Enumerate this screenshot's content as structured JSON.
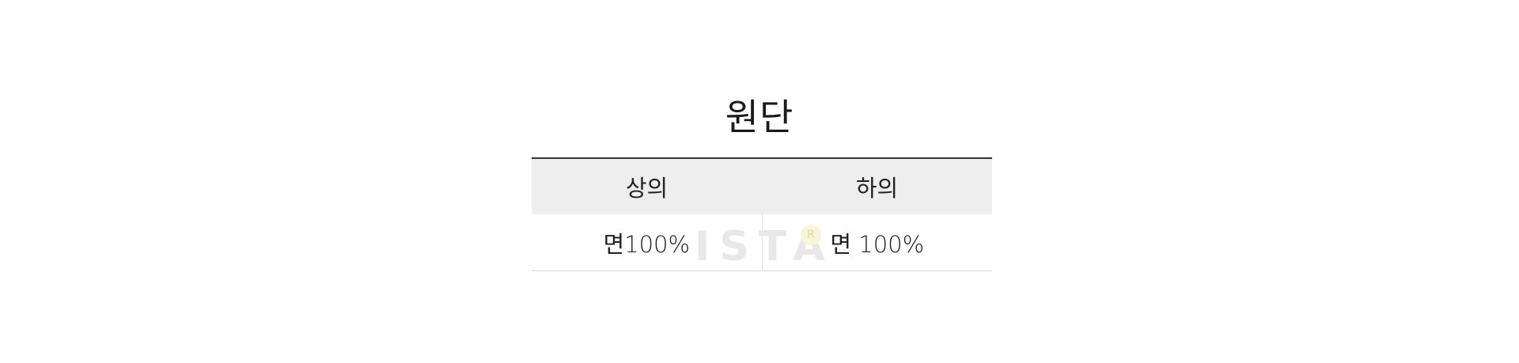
{
  "title": "원단",
  "table": {
    "headers": [
      "상의",
      "하의"
    ],
    "rows": [
      [
        "면100%",
        "면 100%"
      ]
    ]
  },
  "watermark": {
    "text": "ISTA",
    "mark": "R"
  }
}
